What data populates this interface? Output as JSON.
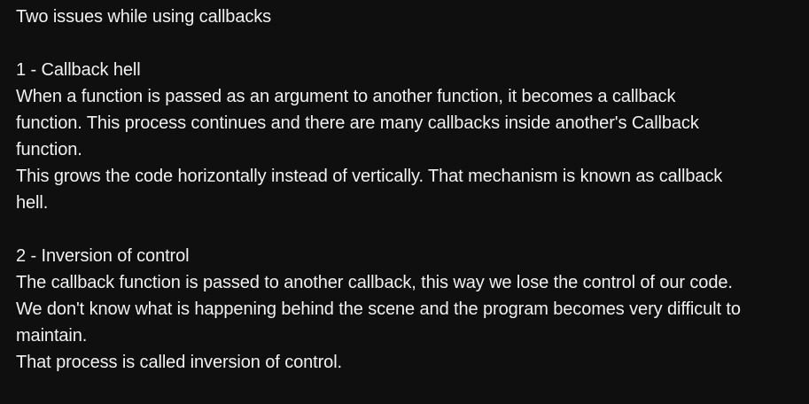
{
  "comment": {
    "lines": [
      "Two issues while using callbacks",
      "",
      "1 - Callback hell",
      "When a function is passed as an argument to another function, it becomes a callback",
      "function. This process continues and there are many callbacks inside another's Callback",
      "function.",
      "This grows the code horizontally instead of vertically. That mechanism is known as callback",
      "hell.",
      "",
      "2 - Inversion of control",
      "The callback function is passed to another callback, this way we lose the control of our code.",
      "We don't know what is happening behind the scene and the program becomes very difficult to",
      "maintain.",
      "That process is called inversion of control."
    ]
  }
}
